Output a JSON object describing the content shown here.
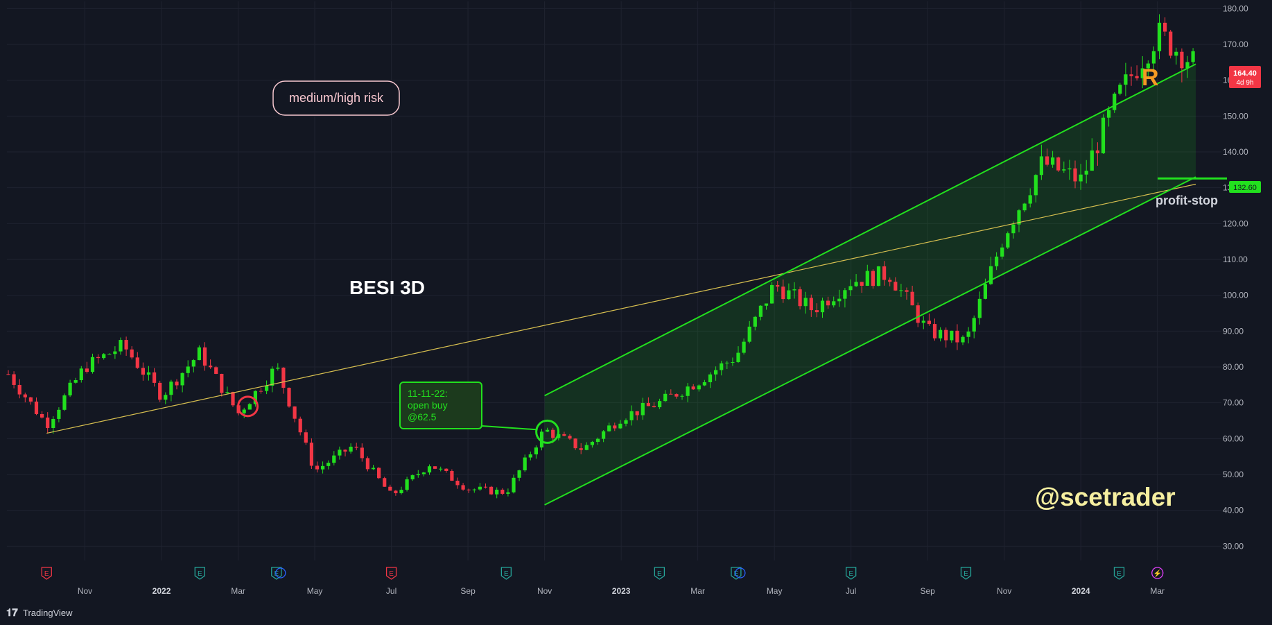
{
  "header": {},
  "annotations": {
    "risk_badge": "medium/high risk",
    "ticker_label": "BESI 3D",
    "trade_note_line1": "11-11-22:",
    "trade_note_line2": "open buy",
    "trade_note_line3": "@62.5",
    "resistance_label": "R",
    "stop_label": "profit-stop",
    "author": "@scetrader"
  },
  "price_tags": {
    "last_price": "164.40",
    "countdown": "4d 9h",
    "stop_price": "132.60"
  },
  "footer": {
    "brand": "TradingView"
  },
  "colors": {
    "background": "#131722",
    "up_candle": "#22e01e",
    "down_candle": "#f23645",
    "trendline": "#d8c050",
    "channel": "#22e01e",
    "axis_text": "#b2b5be",
    "author_text": "#f6efa0"
  },
  "events": [
    {
      "letter": "E",
      "kind": "bad",
      "at": "Oct-2021"
    },
    {
      "letter": "E",
      "kind": "good",
      "at": "Feb-2022"
    },
    {
      "letter": "E",
      "kind": "good",
      "at": "Apr-2022",
      "dividend": true
    },
    {
      "letter": "E",
      "kind": "bad",
      "at": "Jul-2022"
    },
    {
      "letter": "E",
      "kind": "good",
      "at": "Oct-2022"
    },
    {
      "letter": "E",
      "kind": "good",
      "at": "Feb-2023"
    },
    {
      "letter": "E",
      "kind": "good",
      "at": "Apr-2023",
      "dividend": true
    },
    {
      "letter": "E",
      "kind": "good",
      "at": "Jul-2023"
    },
    {
      "letter": "E",
      "kind": "good",
      "at": "Oct-2023"
    },
    {
      "letter": "E",
      "kind": "good",
      "at": "Feb-2024"
    },
    {
      "letter": "⚡",
      "kind": "flash",
      "at": "Mar-2024"
    }
  ],
  "chart_data": {
    "type": "candlestick",
    "title": "BESI 3D",
    "ylim": [
      26,
      182
    ],
    "y_ticks": [
      "30.00",
      "40.00",
      "50.00",
      "60.00",
      "70.00",
      "80.00",
      "90.00",
      "100.00",
      "110.00",
      "120.00",
      "130.00",
      "140.00",
      "150.00",
      "160.00",
      "170.00",
      "180.00"
    ],
    "x_ticks": [
      "Nov",
      "2022",
      "Mar",
      "May",
      "Jul",
      "Sep",
      "Nov",
      "2023",
      "Mar",
      "May",
      "Jul",
      "Sep",
      "Nov",
      "2024",
      "Mar"
    ],
    "bold_x_ticks": [
      "2022",
      "2023",
      "2024"
    ],
    "x_range": [
      "Sep-2021",
      "Apr-2024"
    ],
    "series": [
      {
        "at": "Sep-2021",
        "close": 78
      },
      {
        "at": "Oct-2021",
        "close": 64
      },
      {
        "at": "Nov-2021",
        "close": 80
      },
      {
        "at": "Dec-2021",
        "close": 86
      },
      {
        "at": "Jan-2022",
        "close": 72
      },
      {
        "at": "Feb-2022",
        "close": 84
      },
      {
        "at": "Mar-2022",
        "close": 67
      },
      {
        "at": "Apr-2022",
        "close": 80
      },
      {
        "at": "May-2022",
        "close": 51
      },
      {
        "at": "Jun-2022",
        "close": 58
      },
      {
        "at": "Jul-2022",
        "close": 44
      },
      {
        "at": "Aug-2022",
        "close": 53
      },
      {
        "at": "Sep-2022",
        "close": 46
      },
      {
        "at": "Oct-2022",
        "close": 45
      },
      {
        "at": "Nov-2022",
        "close": 62.5
      },
      {
        "at": "Dec-2022",
        "close": 57
      },
      {
        "at": "Jan-2023",
        "close": 66
      },
      {
        "at": "Feb-2023",
        "close": 70
      },
      {
        "at": "Mar-2023",
        "close": 76
      },
      {
        "at": "Apr-2023",
        "close": 83
      },
      {
        "at": "May-2023",
        "close": 103
      },
      {
        "at": "Jun-2023",
        "close": 96
      },
      {
        "at": "Jul-2023",
        "close": 104
      },
      {
        "at": "Aug-2023",
        "close": 106
      },
      {
        "at": "Sep-2023",
        "close": 90
      },
      {
        "at": "Oct-2023",
        "close": 87
      },
      {
        "at": "Nov-2023",
        "close": 117
      },
      {
        "at": "Dec-2023",
        "close": 137
      },
      {
        "at": "Jan-2024",
        "close": 132
      },
      {
        "at": "Feb-2024",
        "close": 156
      },
      {
        "at": "Mar-2024",
        "close": 173
      },
      {
        "at": "Apr-2024",
        "close": 164.4
      }
    ],
    "trendline": [
      {
        "at": "Oct-2021",
        "price": 61.5
      },
      {
        "at": "Apr-2024",
        "price": 131
      }
    ],
    "channel_upper": [
      {
        "at": "Nov-2022",
        "price": 72
      },
      {
        "at": "Apr-2024",
        "price": 164.5
      }
    ],
    "channel_lower": [
      {
        "at": "Nov-2022",
        "price": 41.5
      },
      {
        "at": "Apr-2024",
        "price": 133
      }
    ],
    "entry": {
      "at": "Nov-2022",
      "price": 62.5
    },
    "exit_marker": {
      "at": "Mar-2022",
      "price": 69
    },
    "profit_stop": 132.6,
    "last_price": 164.4,
    "grid": true
  }
}
